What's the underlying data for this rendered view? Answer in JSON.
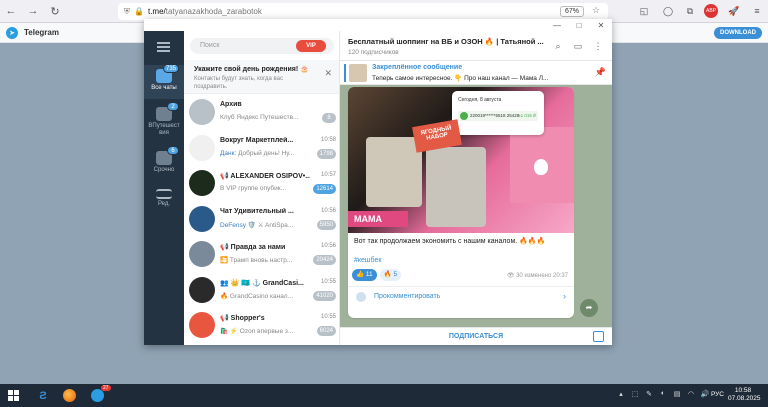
{
  "browser": {
    "url_host": "t.me/",
    "url_path": "tatyanazakhoda_zarabotok",
    "zoom": "67%",
    "back_icon": "←",
    "forward_icon": "→",
    "reload_icon": "↻"
  },
  "telegram_header": {
    "title": "Telegram",
    "download_label": "DOWNLOAD"
  },
  "window_controls": {
    "minimize": "—",
    "maximize": "□",
    "close": "✕"
  },
  "leftnav": {
    "items": [
      {
        "label": "Все чаты",
        "badge": "735"
      },
      {
        "label": "ВПутешест вия",
        "badge": "2"
      },
      {
        "label": "Срочно",
        "badge": "6"
      },
      {
        "label": "Ред.",
        "badge": ""
      }
    ]
  },
  "chatlist": {
    "search_placeholder": "Поиск",
    "birthday_title": "Укажите свой день рождения! 🎂",
    "birthday_sub": "Контакты будут знать, когда вас поздравить.",
    "chats": [
      {
        "name": "Архив",
        "time": "",
        "from": "",
        "msg": "Клуб Яндекс Путешеств...",
        "count": "8",
        "color": "#b8c0c8",
        "unread_blue": false
      },
      {
        "name": "Вокруг Маркетплей...",
        "time": "10:58",
        "from": "Данк:",
        "msg": " Добрый день! Ну...",
        "count": "1798",
        "color": "#f0f0f0",
        "unread_blue": false
      },
      {
        "name": "📢 ALEXANDER OSIPOV•...",
        "time": "10:57",
        "from": "",
        "msg": "В VIP группе опубик...",
        "count": "12614",
        "color": "#1d2b1d",
        "unread_blue": true
      },
      {
        "name": "Чат Удивительный ...",
        "time": "10:56",
        "from": "DeFensy",
        "msg": " 🛡️ ⚔ AntiSpa...",
        "count": "5950",
        "color": "#2a5a8a",
        "unread_blue": false
      },
      {
        "name": "📢 Правда за нами",
        "time": "10:56",
        "from": "",
        "msg": "🎦 Трамп вновь настр...",
        "count": "20424",
        "color": "#7a8a9a",
        "unread_blue": false
      },
      {
        "name": "👥 👑 🇰🇿 ⚓ GrandCasi...",
        "time": "10:55",
        "from": "",
        "msg": "🔥 GrandCasino канал...",
        "count": "41020",
        "color": "#2a2a2a",
        "unread_blue": false
      },
      {
        "name": "📢 Shopper's",
        "time": "10:55",
        "from": "",
        "msg": "🛍️ ⚡ Ozon впервые з...",
        "count": "6024",
        "color": "#e8563f",
        "unread_blue": false
      }
    ]
  },
  "channel": {
    "title": "Бесплатный шоппинг на ВБ и ОЗОН 🔥 | Татьяной ...",
    "subscribers": "120 подписчиков",
    "pinned_title": "Закреплённое сообщение",
    "pinned_text": "Теперь самое интересное. 👇 Про наш канал — Мама Л...",
    "post_text": "Вот так продолжаем экономить с нашим каналом. 🔥🔥🔥",
    "hashtag": "#кешбек",
    "reactions": [
      {
        "label": "👍 11",
        "mine": true
      },
      {
        "label": "🔥 5",
        "mine": false
      }
    ],
    "views": "👁 30",
    "edited": "изменено 20:37",
    "comment_label": "Прокомментировать",
    "subscribe_label": "ПОДПИСАТЬСЯ",
    "card_date": "Сегодня, 8 августа",
    "card_value": "220019******6518 25428...",
    "card_plus": "+1 015 ₽",
    "set_label": "ЯГОДНЫЙ НАБОР",
    "mama_label": "МАМА"
  },
  "taskbar": {
    "lang": "РУС",
    "time": "10:58",
    "date": "07.08.2025",
    "telegram_badge": "27"
  }
}
